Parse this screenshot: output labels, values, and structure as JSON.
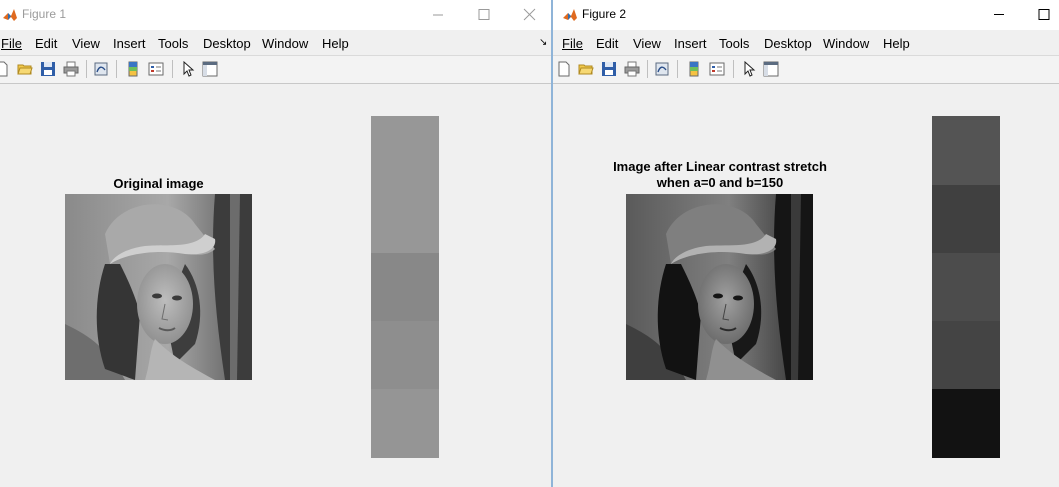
{
  "figure1": {
    "title": "Figure 1",
    "menu": [
      "File",
      "Edit",
      "View",
      "Insert",
      "Tools",
      "Desktop",
      "Window",
      "Help"
    ],
    "plot_title_lines": [
      "Original image"
    ],
    "colorbar_levels": [
      0.59,
      0.59,
      0.53,
      0.56,
      0.58
    ],
    "colorbar_colors": [
      "#979797",
      "#979797",
      "#888888",
      "#8e8e8e",
      "#959595"
    ]
  },
  "figure2": {
    "title": "Figure 2",
    "menu": [
      "File",
      "Edit",
      "View",
      "Insert",
      "Tools",
      "Desktop",
      "Window",
      "Help"
    ],
    "plot_title_lines": [
      "Image after Linear contrast stretch",
      "when a=0 and b=150"
    ],
    "colorbar_colors": [
      "#545454",
      "#404040",
      "#4c4c4c",
      "#444444",
      "#121212"
    ]
  }
}
